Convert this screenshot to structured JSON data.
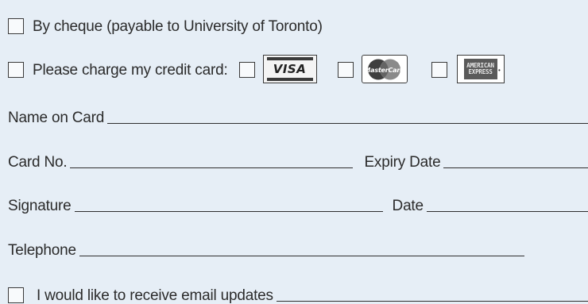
{
  "payment": {
    "cheque_label": "By cheque (payable to University of Toronto)",
    "credit_label": "Please charge my credit card:",
    "cards": [
      {
        "name": "VISA",
        "icon": "visa-logo"
      },
      {
        "name": "MasterCard",
        "icon": "mastercard-logo"
      },
      {
        "name": "AMERICAN EXPRESS",
        "icon": "amex-logo"
      }
    ]
  },
  "fields": {
    "name_on_card": "Name on Card",
    "card_no": "Card No.",
    "expiry_date": "Expiry Date",
    "signature": "Signature",
    "date": "Date",
    "telephone": "Telephone",
    "email_updates": "I would like to receive email updates"
  },
  "colors": {
    "background": "#e6eef6",
    "ink": "#2b2b2b"
  }
}
